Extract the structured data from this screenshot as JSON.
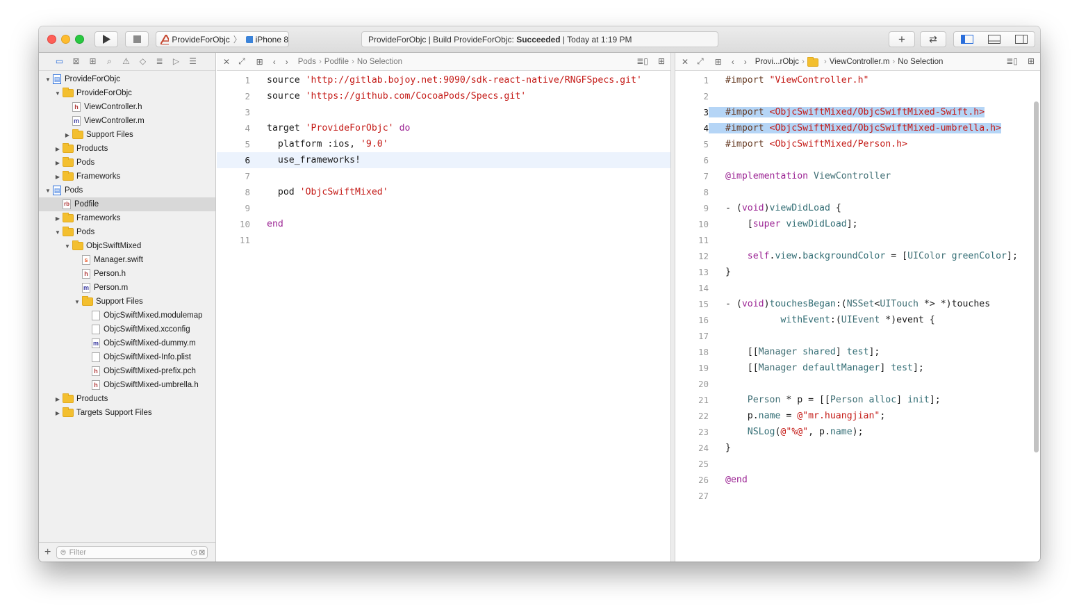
{
  "toolbar": {
    "scheme_name": "ProvideForObjc",
    "device_name": "iPhone 8",
    "activity_prefix": "ProvideForObjc | Build ProvideForObjc: ",
    "activity_status": "Succeeded",
    "activity_suffix": " | Today at 1:19 PM"
  },
  "navigator": {
    "filter_placeholder": "Filter",
    "tree": [
      {
        "label": "ProvideForObjc",
        "depth": 0,
        "kind": "proj",
        "disc": "open"
      },
      {
        "label": "ProvideForObjc",
        "depth": 1,
        "kind": "folder",
        "disc": "open"
      },
      {
        "label": "ViewController.h",
        "depth": 2,
        "kind": "h",
        "disc": ""
      },
      {
        "label": "ViewController.m",
        "depth": 2,
        "kind": "m",
        "disc": ""
      },
      {
        "label": "Support Files",
        "depth": 2,
        "kind": "folder",
        "disc": "closed"
      },
      {
        "label": "Products",
        "depth": 1,
        "kind": "folder",
        "disc": "closed"
      },
      {
        "label": "Pods",
        "depth": 1,
        "kind": "folder",
        "disc": "closed"
      },
      {
        "label": "Frameworks",
        "depth": 1,
        "kind": "folder",
        "disc": "closed"
      },
      {
        "label": "Pods",
        "depth": 0,
        "kind": "proj",
        "disc": "open"
      },
      {
        "label": "Podfile",
        "depth": 1,
        "kind": "rb",
        "disc": "",
        "selected": true
      },
      {
        "label": "Frameworks",
        "depth": 1,
        "kind": "folder",
        "disc": "closed"
      },
      {
        "label": "Pods",
        "depth": 1,
        "kind": "folder",
        "disc": "open"
      },
      {
        "label": "ObjcSwiftMixed",
        "depth": 2,
        "kind": "folder",
        "disc": "open"
      },
      {
        "label": "Manager.swift",
        "depth": 3,
        "kind": "swift",
        "disc": ""
      },
      {
        "label": "Person.h",
        "depth": 3,
        "kind": "h",
        "disc": ""
      },
      {
        "label": "Person.m",
        "depth": 3,
        "kind": "m",
        "disc": ""
      },
      {
        "label": "Support Files",
        "depth": 3,
        "kind": "folder",
        "disc": "open"
      },
      {
        "label": "ObjcSwiftMixed.modulemap",
        "depth": 4,
        "kind": "blank",
        "disc": ""
      },
      {
        "label": "ObjcSwiftMixed.xcconfig",
        "depth": 4,
        "kind": "blank",
        "disc": ""
      },
      {
        "label": "ObjcSwiftMixed-dummy.m",
        "depth": 4,
        "kind": "m",
        "disc": ""
      },
      {
        "label": "ObjcSwiftMixed-Info.plist",
        "depth": 4,
        "kind": "blank",
        "disc": ""
      },
      {
        "label": "ObjcSwiftMixed-prefix.pch",
        "depth": 4,
        "kind": "h",
        "disc": ""
      },
      {
        "label": "ObjcSwiftMixed-umbrella.h",
        "depth": 4,
        "kind": "h",
        "disc": ""
      },
      {
        "label": "Products",
        "depth": 1,
        "kind": "folder",
        "disc": "closed"
      },
      {
        "label": "Targets Support Files",
        "depth": 1,
        "kind": "folder",
        "disc": "closed"
      }
    ]
  },
  "left_editor": {
    "breadcrumb": [
      "Pods",
      "Podfile",
      "No Selection"
    ],
    "current_line": 6,
    "lines": [
      [
        [
          "",
          "source "
        ],
        [
          "str",
          "'http://gitlab.bojoy.net:9090/sdk-react-native/RNGFSpecs.git'"
        ]
      ],
      [
        [
          "",
          "source "
        ],
        [
          "str",
          "'https://github.com/CocoaPods/Specs.git'"
        ]
      ],
      [],
      [
        [
          "",
          "target "
        ],
        [
          "str",
          "'ProvideForObjc'"
        ],
        [
          "",
          " "
        ],
        [
          "kw",
          "do"
        ]
      ],
      [
        [
          "",
          "  platform :ios, "
        ],
        [
          "str",
          "'9.0'"
        ]
      ],
      [
        [
          "",
          "  use_frameworks!"
        ]
      ],
      [],
      [
        [
          "",
          "  pod "
        ],
        [
          "str",
          "'ObjcSwiftMixed'"
        ]
      ],
      [],
      [
        [
          "kw",
          "end"
        ]
      ],
      []
    ]
  },
  "right_editor": {
    "breadcrumb": [
      "Provi...rObjc",
      "",
      "ViewController.m",
      "No Selection"
    ],
    "highlighted_lines": [
      3,
      4
    ],
    "lines": [
      [
        [
          "pp",
          "#import "
        ],
        [
          "str",
          "\"ViewController.h\""
        ]
      ],
      [],
      [
        [
          "pp",
          "#import "
        ],
        [
          "str",
          "<ObjcSwiftMixed/ObjcSwiftMixed-Swift.h>"
        ]
      ],
      [
        [
          "pp",
          "#import "
        ],
        [
          "str",
          "<ObjcSwiftMixed/ObjcSwiftMixed-umbrella.h>"
        ]
      ],
      [
        [
          "pp",
          "#import "
        ],
        [
          "str",
          "<ObjcSwiftMixed/Person.h>"
        ]
      ],
      [],
      [
        [
          "kw",
          "@implementation"
        ],
        [
          "",
          " "
        ],
        [
          "typ",
          "ViewController"
        ]
      ],
      [],
      [
        [
          "",
          "- ("
        ],
        [
          "kw",
          "void"
        ],
        [
          "",
          ")"
        ],
        [
          "fn",
          "viewDidLoad"
        ],
        [
          "",
          " {"
        ]
      ],
      [
        [
          "",
          "    ["
        ],
        [
          "kw",
          "super"
        ],
        [
          "",
          " "
        ],
        [
          "fn",
          "viewDidLoad"
        ],
        [
          "",
          "];"
        ]
      ],
      [],
      [
        [
          "",
          "    "
        ],
        [
          "kw",
          "self"
        ],
        [
          "",
          "."
        ],
        [
          "prop",
          "view"
        ],
        [
          "",
          "."
        ],
        [
          "prop",
          "backgroundColor"
        ],
        [
          "",
          " = ["
        ],
        [
          "typ",
          "UIColor"
        ],
        [
          "",
          " "
        ],
        [
          "fn",
          "greenColor"
        ],
        [
          "",
          "];"
        ]
      ],
      [
        [
          "",
          "}"
        ]
      ],
      [],
      [
        [
          "",
          "- ("
        ],
        [
          "kw",
          "void"
        ],
        [
          "",
          ")"
        ],
        [
          "fn",
          "touchesBegan"
        ],
        [
          "",
          ":("
        ],
        [
          "typ",
          "NSSet"
        ],
        [
          "",
          "<"
        ],
        [
          "typ",
          "UITouch"
        ],
        [
          "",
          " *> *)touches"
        ]
      ],
      [
        [
          "",
          "          "
        ],
        [
          "fn",
          "withEvent"
        ],
        [
          "",
          ":("
        ],
        [
          "typ",
          "UIEvent"
        ],
        [
          "",
          " *)event {"
        ]
      ],
      [],
      [
        [
          "",
          "    [["
        ],
        [
          "typ",
          "Manager"
        ],
        [
          "",
          " "
        ],
        [
          "fn",
          "shared"
        ],
        [
          "",
          "] "
        ],
        [
          "fn",
          "test"
        ],
        [
          "",
          "];"
        ]
      ],
      [
        [
          "",
          "    [["
        ],
        [
          "typ",
          "Manager"
        ],
        [
          "",
          " "
        ],
        [
          "fn",
          "defaultManager"
        ],
        [
          "",
          "] "
        ],
        [
          "fn",
          "test"
        ],
        [
          "",
          "];"
        ]
      ],
      [],
      [
        [
          "",
          "    "
        ],
        [
          "typ",
          "Person"
        ],
        [
          "",
          " * p = [["
        ],
        [
          "typ",
          "Person"
        ],
        [
          "",
          " "
        ],
        [
          "fn",
          "alloc"
        ],
        [
          "",
          "] "
        ],
        [
          "fn",
          "init"
        ],
        [
          "",
          "];"
        ]
      ],
      [
        [
          "",
          "    p."
        ],
        [
          "prop",
          "name"
        ],
        [
          "",
          " = "
        ],
        [
          "str",
          "@\"mr.huangjian\""
        ],
        [
          "",
          ";"
        ]
      ],
      [
        [
          "",
          "    "
        ],
        [
          "fn",
          "NSLog"
        ],
        [
          "",
          "("
        ],
        [
          "str",
          "@\"%@\""
        ],
        [
          "",
          ", p."
        ],
        [
          "prop",
          "name"
        ],
        [
          "",
          ");"
        ]
      ],
      [
        [
          "",
          "}"
        ]
      ],
      [],
      [
        [
          "kw",
          "@end"
        ]
      ],
      []
    ]
  }
}
